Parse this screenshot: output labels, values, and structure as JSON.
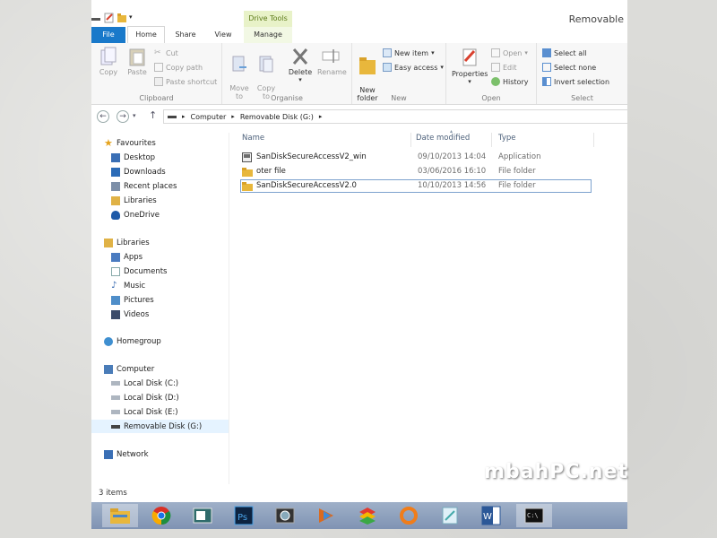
{
  "window": {
    "title": "Removable"
  },
  "ribbon_tabs": {
    "file": "File",
    "home": "Home",
    "share": "Share",
    "view": "View",
    "drive_tools": "Drive Tools",
    "manage": "Manage"
  },
  "ribbon": {
    "clipboard": {
      "label": "Clipboard",
      "copy": "Copy",
      "paste": "Paste",
      "cut": "Cut",
      "copy_path": "Copy path",
      "paste_shortcut": "Paste shortcut"
    },
    "organise": {
      "label": "Organise",
      "move_to": "Move\nto",
      "copy_to": "Copy\nto",
      "delete": "Delete",
      "rename": "Rename"
    },
    "new": {
      "label": "New",
      "new_folder": "New\nfolder",
      "new_item": "New item",
      "easy_access": "Easy access"
    },
    "open": {
      "label": "Open",
      "properties": "Properties",
      "open": "Open",
      "edit": "Edit",
      "history": "History"
    },
    "select": {
      "label": "Select",
      "select_all": "Select all",
      "select_none": "Select none",
      "invert_selection": "Invert selection"
    }
  },
  "address": {
    "computer": "Computer",
    "drive": "Removable Disk (G:)"
  },
  "nav": {
    "favourites": "Favourites",
    "desktop": "Desktop",
    "downloads": "Downloads",
    "recent_places": "Recent places",
    "libraries_fav": "Libraries",
    "onedrive": "OneDrive",
    "libraries": "Libraries",
    "apps": "Apps",
    "documents": "Documents",
    "music": "Music",
    "pictures": "Pictures",
    "videos": "Videos",
    "homegroup": "Homegroup",
    "computer": "Computer",
    "local_c": "Local Disk (C:)",
    "local_d": "Local Disk (D:)",
    "local_e": "Local Disk (E:)",
    "removable_g": "Removable Disk (G:)",
    "network": "Network"
  },
  "columns": {
    "name": "Name",
    "date": "Date modified",
    "type": "Type"
  },
  "files": [
    {
      "name": "SanDiskSecureAccessV2_win",
      "date": "09/10/2013 14:04",
      "type": "Application"
    },
    {
      "name": "oter file",
      "date": "03/06/2016 16:10",
      "type": "File folder"
    },
    {
      "name": "SanDiskSecureAccessV2.0",
      "date": "10/10/2013 14:56",
      "type": "File folder"
    }
  ],
  "status": {
    "items": "3 items"
  },
  "watermark": "mbahPC.net",
  "colors": {
    "accent": "#1979ca",
    "selection": "#e5f3ff",
    "folder": "#e8b73c",
    "drive_tools": "#5c7a18"
  }
}
